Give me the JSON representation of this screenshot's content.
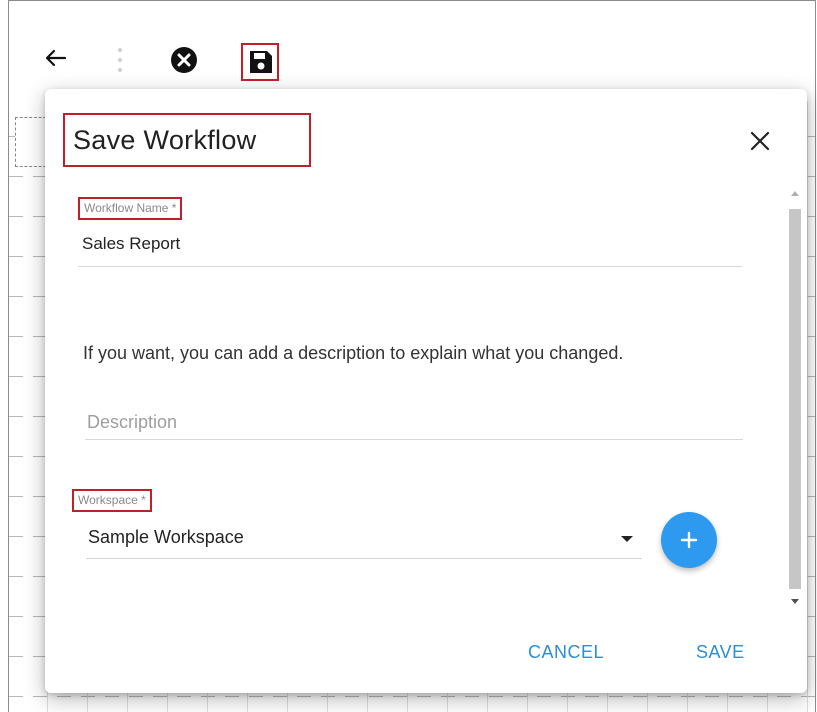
{
  "toolbar": {
    "icons": [
      "back-arrow-icon",
      "more-vertical-icon",
      "close-circle-icon",
      "save-floppy-icon"
    ]
  },
  "dialog": {
    "title": "Save Workflow",
    "workflow_name": {
      "label": "Workflow Name *",
      "value": "Sales Report"
    },
    "help_text": "If you want, you can add a description to explain what you changed.",
    "description": {
      "placeholder": "Description",
      "value": ""
    },
    "workspace": {
      "label": "Workspace *",
      "selected": "Sample Workspace"
    },
    "buttons": {
      "cancel": "CANCEL",
      "save": "SAVE"
    }
  },
  "colors": {
    "accent": "#2b8ed6",
    "fab": "#2d9af0",
    "highlight_border": "#c0202a"
  }
}
